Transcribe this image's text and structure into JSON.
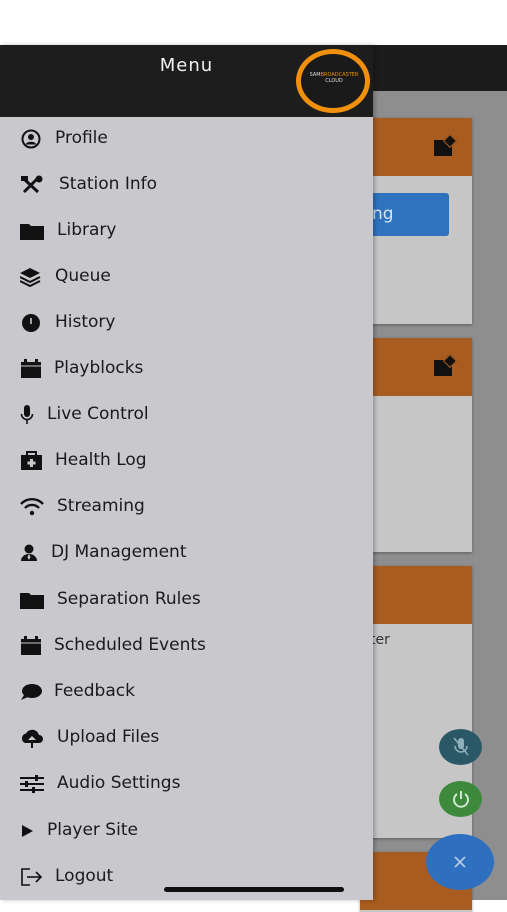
{
  "drawer": {
    "title": "Menu",
    "logo_brand": "SAM",
    "logo_brand2": "BROADCASTER",
    "logo_sub": "CLOUD"
  },
  "menu_items": [
    {
      "label": "Profile",
      "icon": "person-circle-icon"
    },
    {
      "label": "Station Info",
      "icon": "tools-icon"
    },
    {
      "label": "Library",
      "icon": "folder-icon"
    },
    {
      "label": "Queue",
      "icon": "layers-icon"
    },
    {
      "label": "History",
      "icon": "clock-icon"
    },
    {
      "label": "Playblocks",
      "icon": "calendar-icon"
    },
    {
      "label": "Live Control",
      "icon": "microphone-icon"
    },
    {
      "label": "Health Log",
      "icon": "medical-kit-icon"
    },
    {
      "label": "Streaming",
      "icon": "wifi-icon"
    },
    {
      "label": "DJ Management",
      "icon": "user-tie-icon"
    },
    {
      "label": "Separation Rules",
      "icon": "folder-icon"
    },
    {
      "label": "Scheduled Events",
      "icon": "calendar-icon"
    },
    {
      "label": "Feedback",
      "icon": "chat-bubble-icon"
    },
    {
      "label": "Upload Files",
      "icon": "cloud-upload-icon"
    },
    {
      "label": "Audio Settings",
      "icon": "sliders-icon"
    },
    {
      "label": "Player Site",
      "icon": "play-icon"
    },
    {
      "label": "Logout",
      "icon": "logout-icon"
    }
  ],
  "background": {
    "button_partial": "ng",
    "text_partial": "ter"
  },
  "colors": {
    "accent_orange": "#a85c1f",
    "drawer_bg": "#c9c9cd",
    "header_bg": "#1d1d1d",
    "fab_blue": "#2f6fbf",
    "fab_green": "#3d8a3d",
    "fab_teal": "#2b5866"
  }
}
